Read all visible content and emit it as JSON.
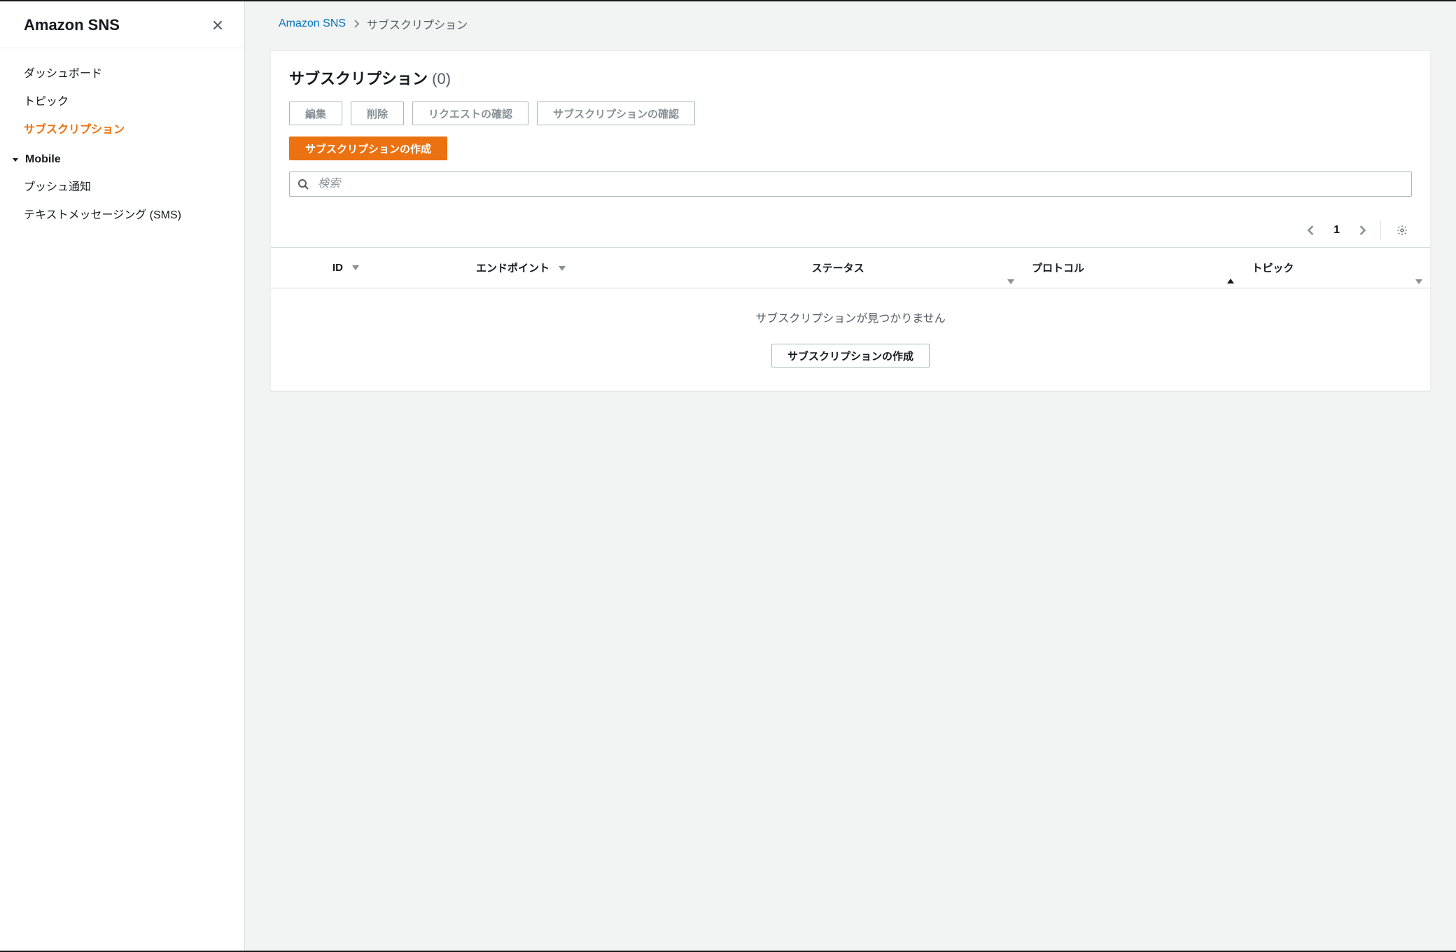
{
  "sidebar": {
    "title": "Amazon SNS",
    "items": [
      {
        "label": "ダッシュボード",
        "active": false
      },
      {
        "label": "トピック",
        "active": false
      },
      {
        "label": "サブスクリプション",
        "active": true
      }
    ],
    "section": {
      "label": "Mobile"
    },
    "section_items": [
      {
        "label": "プッシュ通知"
      },
      {
        "label": "テキストメッセージング (SMS)"
      }
    ]
  },
  "breadcrumb": {
    "root": "Amazon SNS",
    "current": "サブスクリプション"
  },
  "page": {
    "title": "サブスクリプション",
    "count_text": "(0)"
  },
  "actions": {
    "edit": "編集",
    "delete": "削除",
    "confirm_request": "リクエストの確認",
    "confirm_subscription": "サブスクリプションの確認",
    "create_primary": "サブスクリプションの作成"
  },
  "search": {
    "placeholder": "検索"
  },
  "pager": {
    "page": "1"
  },
  "table": {
    "columns": {
      "id": "ID",
      "endpoint": "エンドポイント",
      "status": "ステータス",
      "protocol": "プロトコル",
      "topic": "トピック"
    },
    "sorted_column": "protocol",
    "sort_dir": "asc",
    "rows": [],
    "empty_message": "サブスクリプションが見つかりません",
    "empty_action_label": "サブスクリプションの作成"
  }
}
